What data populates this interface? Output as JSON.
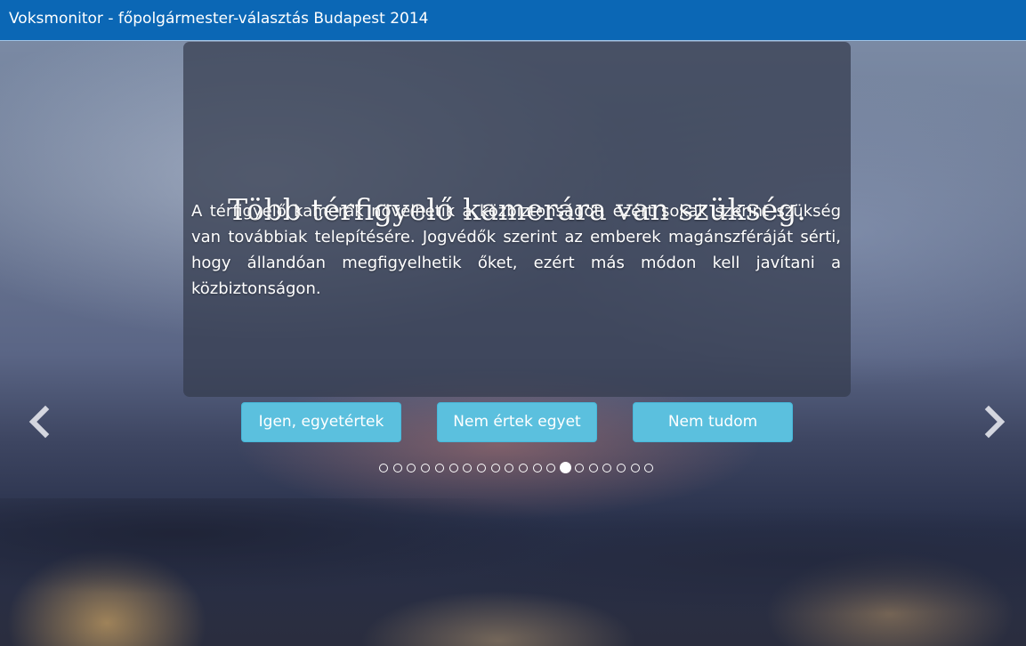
{
  "header": {
    "title": "Voksmonitor - főpolgármester-választás Budapest 2014"
  },
  "question": {
    "title": "Több térfigyelő kamerára van szükség.",
    "description": "A térfigyelő kamerák növelhetik a közbiztonságot, ezért sokak szerint szükség van továbbiak telepítésére. Jogvédők szerint az emberek magánszféráját sérti, hogy állandóan megfigyelhetik őket, ezért más módon kell javítani a közbiztonságon."
  },
  "answers": {
    "yes_label": "Igen, egyetértek",
    "no_label": "Nem értek egyet",
    "dunno_label": "Nem tudom"
  },
  "navigation": {
    "prev_icon": "chevron-left-icon",
    "next_icon": "chevron-right-icon"
  },
  "pagination": {
    "total": 20,
    "current": 14
  },
  "colors": {
    "header_bg": "#0b67b5",
    "button_bg": "#5bc0de"
  }
}
